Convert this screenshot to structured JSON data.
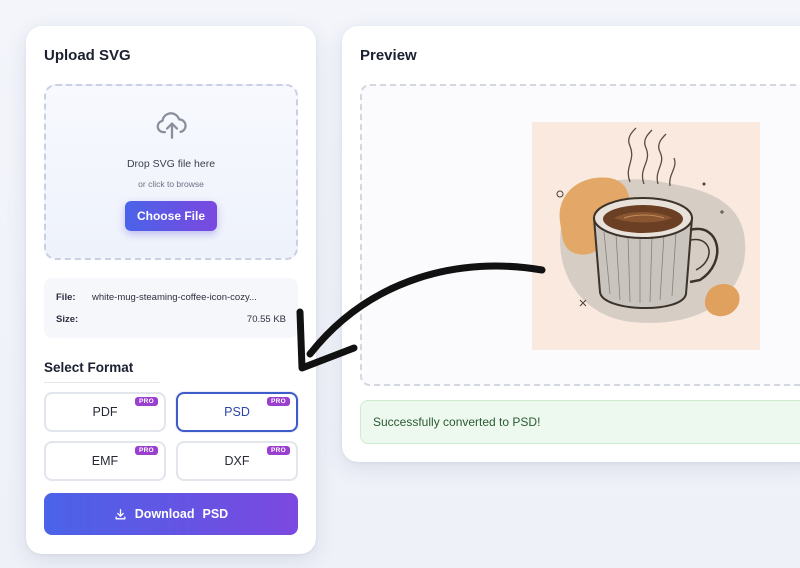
{
  "upload": {
    "title": "Upload SVG",
    "drop_text": "Drop SVG file here",
    "drop_sub": "or click to browse",
    "choose_label": "Choose File"
  },
  "file_info": {
    "file_label": "File:",
    "file_value": "white-mug-steaming-coffee-icon-cozy...",
    "size_label": "Size:",
    "size_value": "70.55 KB"
  },
  "format": {
    "title": "Select Format",
    "badge": "PRO",
    "options": [
      {
        "label": "PDF",
        "selected": false
      },
      {
        "label": "PSD",
        "selected": true
      },
      {
        "label": "EMF",
        "selected": false
      },
      {
        "label": "DXF",
        "selected": false
      }
    ]
  },
  "download": {
    "label": "Download",
    "format": "PSD"
  },
  "preview": {
    "title": "Preview",
    "success_message": "Successfully converted to PSD!"
  },
  "icons": {
    "upload": "cloud-upload-icon",
    "download": "download-icon"
  },
  "colors": {
    "accent_start": "#4a63e8",
    "accent_end": "#7b48e0",
    "pro_badge": "#9a3fd0",
    "selected_border": "#3d5bc9",
    "success_bg": "#edf8ee",
    "success_text": "#2c5a33"
  }
}
